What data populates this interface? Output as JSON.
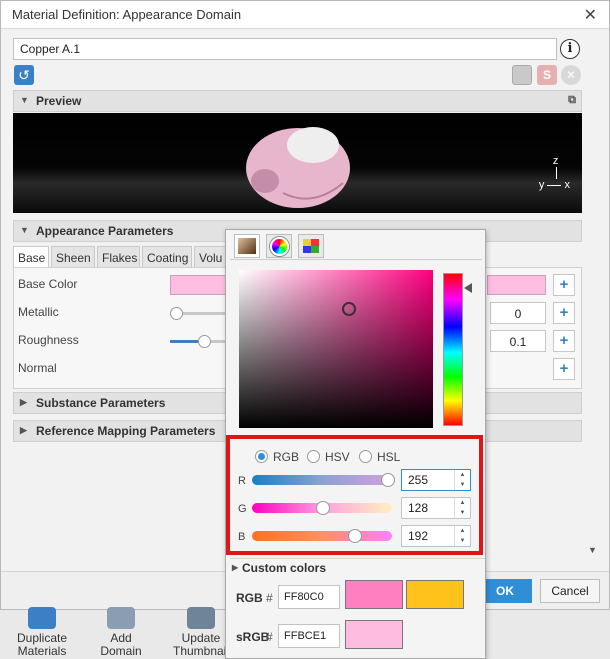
{
  "window": {
    "title": "Material Definition: Appearance Domain"
  },
  "material_name": "Copper A.1",
  "sections": {
    "preview": "Preview",
    "appearance": "Appearance Parameters",
    "substance": "Substance Parameters",
    "reference_mapping": "Reference Mapping Parameters"
  },
  "preview": {
    "axis_z": "z",
    "axis_y": "y",
    "axis_x": "x"
  },
  "tabs": [
    "Base",
    "Sheen",
    "Flakes",
    "Coating",
    "Volu"
  ],
  "params": {
    "base_color": "Base Color",
    "metallic": "Metallic",
    "metallic_value": "0",
    "roughness": "Roughness",
    "roughness_value": "0.1",
    "normal": "Normal"
  },
  "picker": {
    "modes": [
      "RGB",
      "HSV",
      "HSL"
    ],
    "selected_mode": "RGB",
    "channels": [
      {
        "label": "R",
        "value": "255"
      },
      {
        "label": "G",
        "value": "128"
      },
      {
        "label": "B",
        "value": "192"
      }
    ],
    "custom_colors": "Custom colors",
    "rgb_label": "RGB",
    "rgb_hash": "#",
    "rgb_hex": "FF80C0",
    "srgb_label": "sRGB",
    "srgb_hash": "#",
    "srgb_hex": "FFBCE1"
  },
  "buttons": {
    "ok": "OK",
    "cancel": "Cancel"
  },
  "bottom_tools": [
    {
      "line1": "Duplicate",
      "line2": "Materials"
    },
    {
      "line1": "Add",
      "line2": "Domain"
    },
    {
      "line1": "Update",
      "line2": "Thumbnail"
    }
  ],
  "colors": {
    "base_color": "#FFBDE2",
    "accent": "#2F8FD6",
    "highlight": "#E01515",
    "rgb_swatch": "#FF80C0",
    "old_swatch": "#FFC21A",
    "srgb_swatch": "#FFBCE1"
  }
}
